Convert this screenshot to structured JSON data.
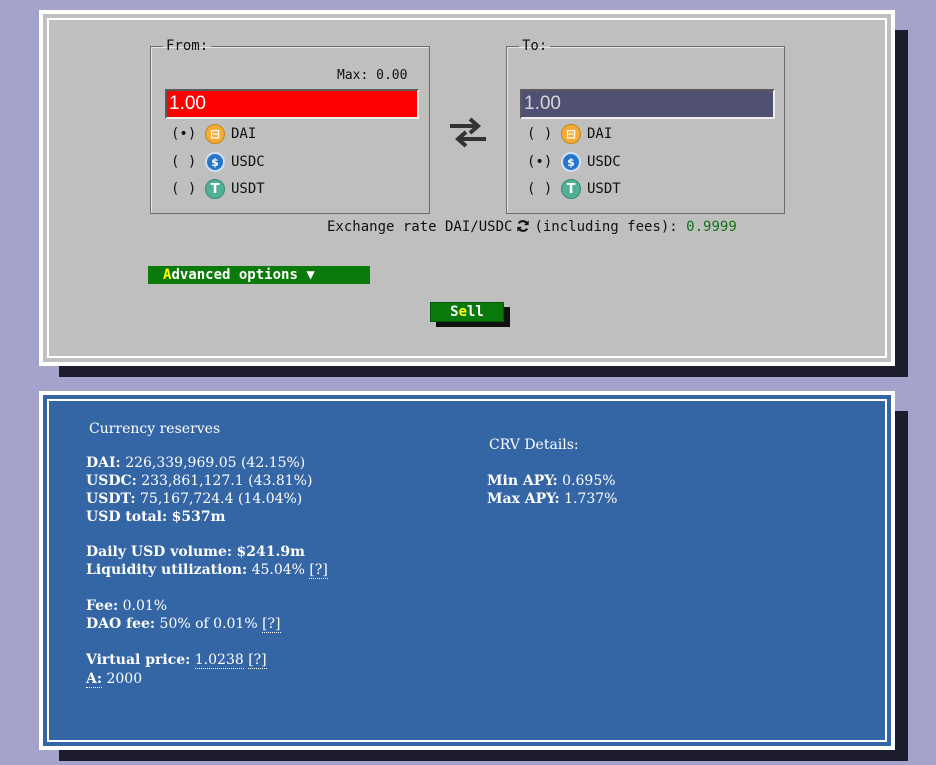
{
  "swap": {
    "from": {
      "legend": "From:",
      "max_label": "Max:",
      "max_value": "0.00",
      "amount": "1.00",
      "coins": [
        {
          "radio": "(•)",
          "name": "DAI",
          "icon": "dai-icon"
        },
        {
          "radio": "( )",
          "name": "USDC",
          "icon": "usdc-icon"
        },
        {
          "radio": "( )",
          "name": "USDT",
          "icon": "usdt-icon"
        }
      ],
      "selected": "DAI"
    },
    "to": {
      "legend": "To:",
      "amount": "1.00",
      "coins": [
        {
          "radio": "( )",
          "name": "DAI",
          "icon": "dai-icon"
        },
        {
          "radio": "(•)",
          "name": "USDC",
          "icon": "usdc-icon"
        },
        {
          "radio": "( )",
          "name": "USDT",
          "icon": "usdt-icon"
        }
      ],
      "selected": "USDC"
    },
    "rate": {
      "prefix": "Exchange rate DAI/USDC",
      "suffix": "(including fees):",
      "value": "0.9999"
    },
    "advanced": {
      "hotkey": "A",
      "rest": "dvanced options",
      "arrow": "▼"
    },
    "sell": {
      "pre": "S",
      "hotkey": "e",
      "rest": "ll"
    }
  },
  "reserves": {
    "title": "Currency reserves",
    "dai": {
      "label": "DAI:",
      "value": "226,339,969.05 (42.15%)"
    },
    "usdc": {
      "label": "USDC:",
      "value": "233,861,127.1 (43.81%)"
    },
    "usdt": {
      "label": "USDT:",
      "value": "75,167,724.4 (14.04%)"
    },
    "usd_total": {
      "label": "USD total:",
      "value": "$537m"
    },
    "daily_volume": {
      "label": "Daily USD volume:",
      "value": "$241.9m"
    },
    "liquidity": {
      "label": "Liquidity utilization:",
      "value": "45.04%",
      "help": "[?]"
    },
    "fee": {
      "label": "Fee:",
      "value": "0.01%"
    },
    "dao_fee": {
      "label": "DAO fee:",
      "value": "50% of 0.01%",
      "help": "[?]"
    },
    "virtual_price": {
      "label": "Virtual price:",
      "value": "1.0238",
      "help": "[?]"
    },
    "a": {
      "label": "A:",
      "value": "2000"
    }
  },
  "crv": {
    "title": "CRV Details:",
    "min_apy": {
      "label": "Min APY:",
      "value": "0.695%"
    },
    "max_apy": {
      "label": "Max APY:",
      "value": "1.737%"
    }
  },
  "colors": {
    "background": "#a3a3cc",
    "swap_panel": "#bfbfbf",
    "reserves_panel": "#3465a4",
    "from_input": "#ff0000",
    "to_input": "#505074",
    "button_green": "#0a7a0a",
    "hotkey_yellow": "#ffff00",
    "rate_value": "#147314"
  }
}
